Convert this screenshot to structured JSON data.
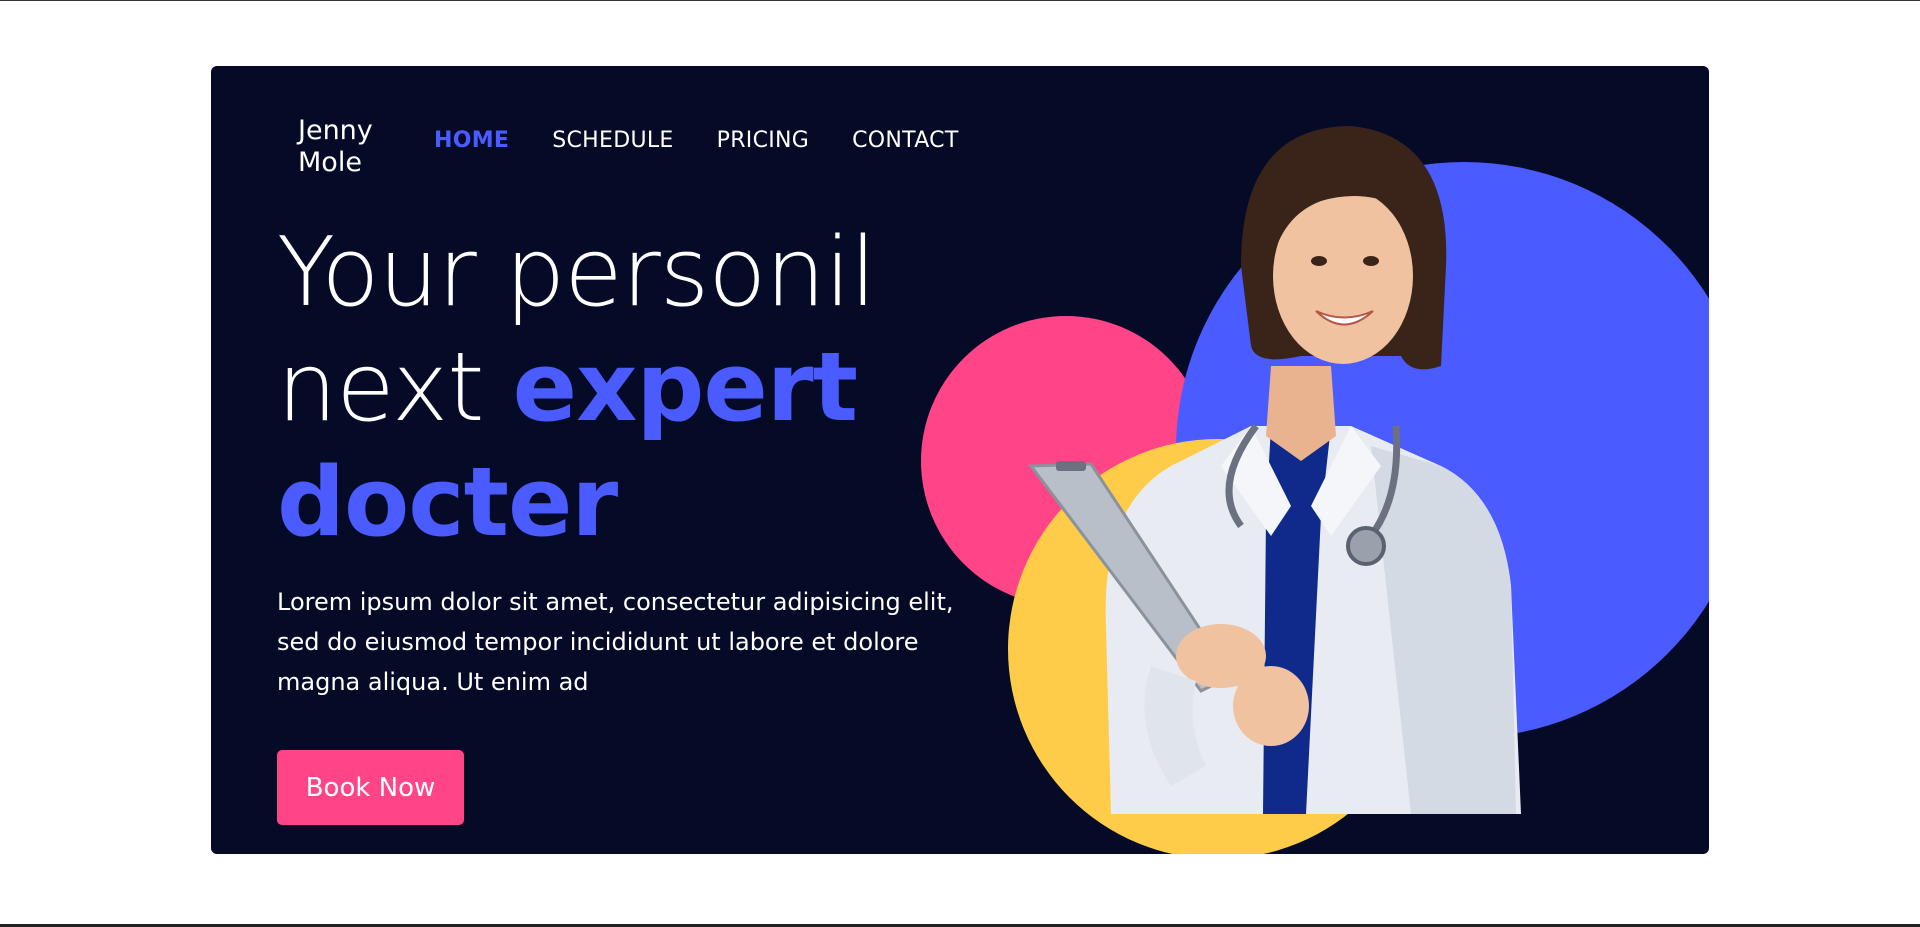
{
  "brand": {
    "line1": "Jenny",
    "line2": "Mole"
  },
  "nav": {
    "items": [
      {
        "label": "HOME",
        "active": true
      },
      {
        "label": "SCHEDULE",
        "active": false
      },
      {
        "label": "PRICING",
        "active": false
      },
      {
        "label": "CONTACT",
        "active": false
      }
    ]
  },
  "hero": {
    "headline_part1": "Your personil",
    "headline_part2": "next ",
    "headline_accent1": "expert",
    "headline_accent2": "docter",
    "paragraph": "Lorem ipsum dolor sit amet, consectetur adipisicing elit, sed do eiusmod tempor incididunt ut labore et dolore magna aliqua. Ut enim ad",
    "cta_label": "Book Now"
  },
  "colors": {
    "background": "#050b27",
    "accent_blue": "#4a5bff",
    "accent_pink": "#ff4488",
    "accent_yellow": "#ffcc4a"
  }
}
